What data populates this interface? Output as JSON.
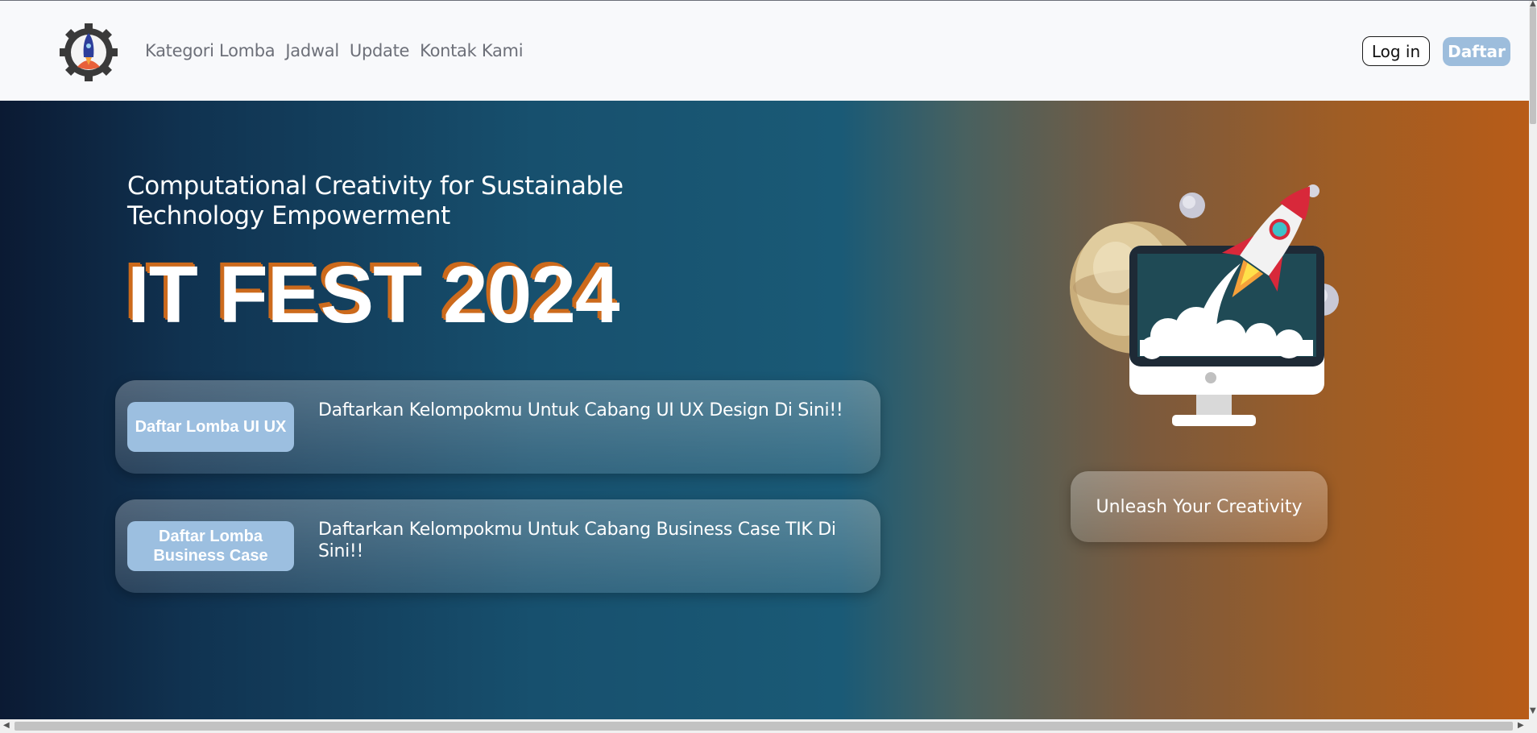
{
  "header": {
    "logo_icon": "rocket-gear-logo-icon",
    "nav": [
      "Kategori Lomba",
      "Jadwal",
      "Update",
      "Kontak Kami"
    ],
    "login_label": "Log in",
    "register_label": "Daftar"
  },
  "hero": {
    "tagline": "Computational Creativity for Sustainable Technology Empowerment",
    "title": "IT FEST 2024",
    "cards": [
      {
        "button": "Daftar Lomba UI UX",
        "text": "Daftarkan Kelompokmu Untuk Cabang UI UX Design Di Sini!!"
      },
      {
        "button": "Daftar Lomba Business Case",
        "text": "Daftarkan Kelompokmu Untuk Cabang Business Case TIK Di Sini!!"
      }
    ],
    "illustration_icon": "rocket-launch-computer-illustration",
    "cta_label": "Unleash Your Creativity"
  },
  "colors": {
    "accent_orange": "#cc6a1c",
    "button_blue": "#9cbfe0",
    "hero_dark": "#0b1a33",
    "hero_orange": "#b85c18"
  }
}
